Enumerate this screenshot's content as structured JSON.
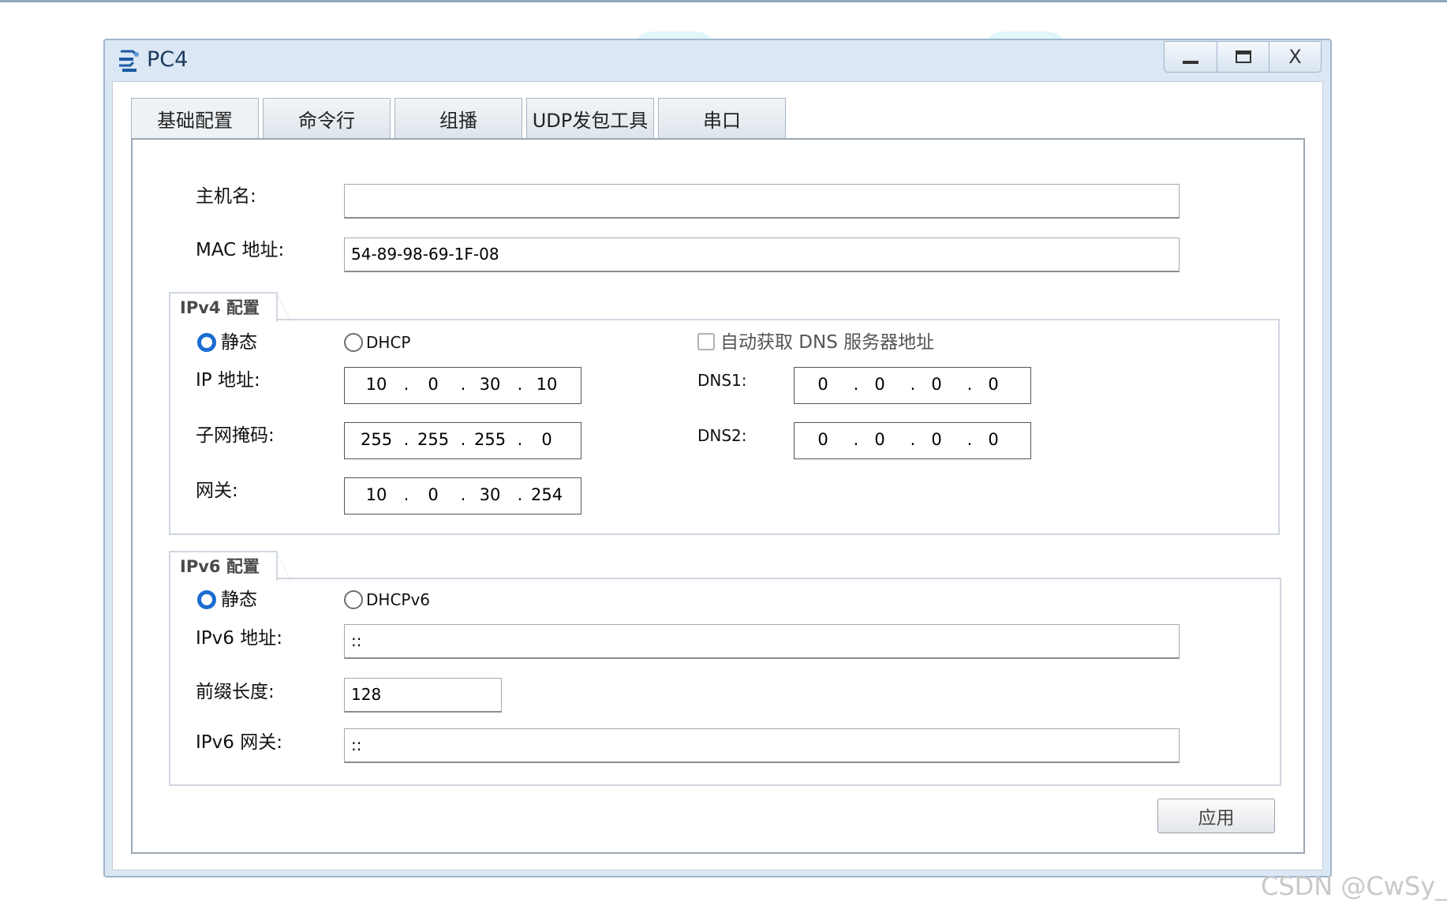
{
  "window": {
    "title": "PC4",
    "controls": {
      "minimize": "minimize",
      "maximize": "maximize",
      "close": "X"
    }
  },
  "tabs": [
    {
      "label": "基础配置",
      "active": true
    },
    {
      "label": "命令行"
    },
    {
      "label": "组播"
    },
    {
      "label": "UDP发包工具"
    },
    {
      "label": "串口"
    }
  ],
  "basic": {
    "hostname_label": "主机名:",
    "hostname_value": "",
    "mac_label": "MAC 地址:",
    "mac_value": "54-89-98-69-1F-08"
  },
  "ipv4": {
    "group_title": "IPv4 配置",
    "static_label": "静态",
    "dhcp_label": "DHCP",
    "auto_dns_label": "自动获取 DNS 服务器地址",
    "mode": "static",
    "auto_dns_checked": false,
    "ip_label": "IP 地址:",
    "ip": [
      "10",
      "0",
      "30",
      "10"
    ],
    "mask_label": "子网掩码:",
    "mask": [
      "255",
      "255",
      "255",
      "0"
    ],
    "gateway_label": "网关:",
    "gateway": [
      "10",
      "0",
      "30",
      "254"
    ],
    "dns1_label": "DNS1:",
    "dns1": [
      "0",
      "0",
      "0",
      "0"
    ],
    "dns2_label": "DNS2:",
    "dns2": [
      "0",
      "0",
      "0",
      "0"
    ]
  },
  "ipv6": {
    "group_title": "IPv6 配置",
    "static_label": "静态",
    "dhcpv6_label": "DHCPv6",
    "mode": "static",
    "address_label": "IPv6 地址:",
    "address_value": "::",
    "prefix_label": "前缀长度:",
    "prefix_value": "128",
    "gateway_label": "IPv6 网关:",
    "gateway_value": "::"
  },
  "apply_label": "应用",
  "watermark": "CSDN @CwSy_",
  "colors": {
    "radio_accent": "#1a6cd1",
    "window_frame": "#dbe7f4",
    "title_text": "#1b3a5e"
  }
}
